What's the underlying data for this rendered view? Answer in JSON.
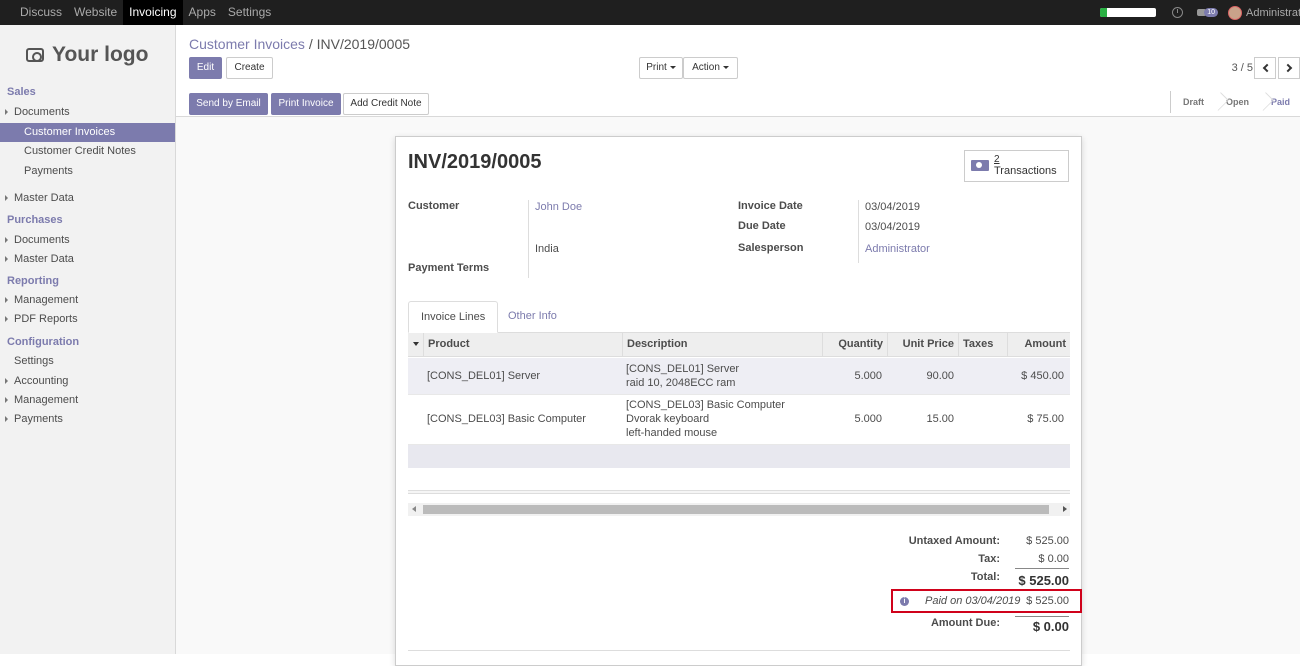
{
  "topbar": {
    "menus": [
      "Discuss",
      "Website",
      "Invoicing",
      "Apps",
      "Settings"
    ],
    "active_menu": "Invoicing",
    "activity_progress": 0.12,
    "message_count": "10",
    "user": "Administrator"
  },
  "sidebar": {
    "logo_text": "Your logo",
    "sections": {
      "sales": "Sales",
      "purchases": "Purchases",
      "reporting": "Reporting",
      "configuration": "Configuration"
    },
    "items": {
      "sales_documents": "Documents",
      "customer_invoices": "Customer Invoices",
      "customer_credit_notes": "Customer Credit Notes",
      "payments": "Payments",
      "sales_master_data": "Master Data",
      "purchases_documents": "Documents",
      "purchases_master_data": "Master Data",
      "management": "Management",
      "pdf_reports": "PDF Reports",
      "settings": "Settings",
      "accounting": "Accounting",
      "config_management": "Management",
      "config_payments": "Payments"
    }
  },
  "control_panel": {
    "breadcrumb_parent": "Customer Invoices",
    "breadcrumb_sep": "/",
    "breadcrumb_current": "INV/2019/0005",
    "edit_label": "Edit",
    "create_label": "Create",
    "print_label": "Print",
    "action_label": "Action",
    "pager": "3 / 5",
    "send_email_label": "Send by Email",
    "print_invoice_label": "Print Invoice",
    "credit_note_label": "Add Credit Note",
    "statuses": [
      "Draft",
      "Open",
      "Paid"
    ],
    "current_status": "Paid"
  },
  "invoice": {
    "number": "INV/2019/0005",
    "transactions_count": "2",
    "transactions_label": "Transactions",
    "customer_label": "Customer",
    "customer_name": "John Doe",
    "customer_country": "India",
    "payment_terms_label": "Payment Terms",
    "invoice_date_label": "Invoice Date",
    "invoice_date": "03/04/2019",
    "due_date_label": "Due Date",
    "due_date": "03/04/2019",
    "salesperson_label": "Salesperson",
    "salesperson": "Administrator",
    "tabs": [
      "Invoice Lines",
      "Other Info"
    ],
    "columns": [
      "Product",
      "Description",
      "Quantity",
      "Unit Price",
      "Taxes",
      "Amount"
    ],
    "lines": [
      {
        "product": "[CONS_DEL01] Server",
        "description": [
          "[CONS_DEL01] Server",
          "raid 10, 2048ECC ram"
        ],
        "quantity": "5.000",
        "unit_price": "90.00",
        "taxes": "",
        "amount": "$ 450.00"
      },
      {
        "product": "[CONS_DEL03] Basic Computer",
        "description": [
          "[CONS_DEL03] Basic Computer",
          "Dvorak keyboard",
          "left-handed mouse"
        ],
        "quantity": "5.000",
        "unit_price": "15.00",
        "taxes": "",
        "amount": "$ 75.00"
      }
    ],
    "untaxed_label": "Untaxed Amount:",
    "untaxed": "$ 525.00",
    "tax_label": "Tax:",
    "tax": "$ 0.00",
    "total_label": "Total:",
    "total": "$ 525.00",
    "paid_on": "Paid on 03/04/2019",
    "paid_amount": "$ 525.00",
    "amount_due_label": "Amount Due:",
    "amount_due": "$ 0.00"
  }
}
